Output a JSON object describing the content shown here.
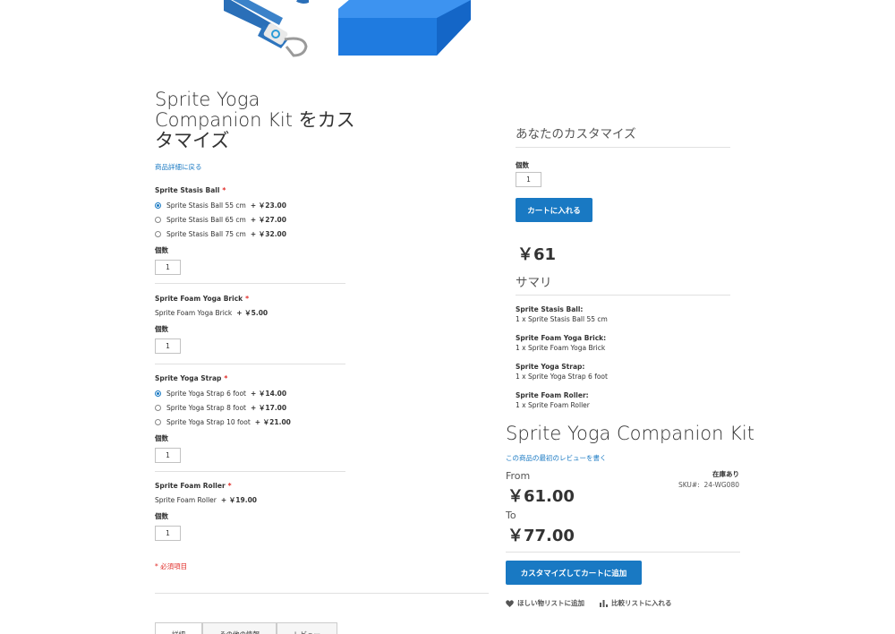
{
  "bundle": {
    "title_line1": "Sprite Yoga",
    "title_line2": "Companion Kit をカス",
    "title_line3": "タマイズ",
    "back_link": "商品詳細に戻る",
    "qty_label": "個数",
    "options": [
      {
        "label": "Sprite Stasis Ball",
        "choices": [
          {
            "name": "Sprite Stasis Ball 55 cm",
            "price": "+ ￥23.00",
            "checked": true
          },
          {
            "name": "Sprite Stasis Ball 65 cm",
            "price": "+ ￥27.00",
            "checked": false
          },
          {
            "name": "Sprite Stasis Ball 75 cm",
            "price": "+ ￥32.00",
            "checked": false
          }
        ],
        "qty": "1"
      },
      {
        "label": "Sprite Foam Yoga Brick",
        "single": {
          "name": "Sprite Foam Yoga Brick",
          "price": "+ ￥5.00"
        },
        "qty": "1"
      },
      {
        "label": "Sprite Yoga Strap",
        "choices": [
          {
            "name": "Sprite Yoga Strap 6 foot",
            "price": "+ ￥14.00",
            "checked": true
          },
          {
            "name": "Sprite Yoga Strap 8 foot",
            "price": "+ ￥17.00",
            "checked": false
          },
          {
            "name": "Sprite Yoga Strap 10 foot",
            "price": "+ ￥21.00",
            "checked": false
          }
        ],
        "qty": "1"
      },
      {
        "label": "Sprite Foam Roller",
        "single": {
          "name": "Sprite Foam Roller",
          "price": "+ ￥19.00"
        },
        "qty": "1"
      }
    ],
    "required_star": "*",
    "required_note": "* 必須項目"
  },
  "tabs": [
    "詳細",
    "その他の情報",
    "レビュー"
  ],
  "customize": {
    "title": "あなたのカスタマイズ",
    "qty_label": "個数",
    "qty": "1",
    "add_to_cart": "カートに入れる",
    "price": "￥61",
    "summary_title": "サマリ",
    "summary": [
      {
        "label": "Sprite Stasis Ball:",
        "value": "1 x Sprite Stasis Ball 55 cm"
      },
      {
        "label": "Sprite Foam Yoga Brick:",
        "value": "1 x Sprite Foam Yoga Brick"
      },
      {
        "label": "Sprite Yoga Strap:",
        "value": "1 x Sprite Yoga Strap 6 foot"
      },
      {
        "label": "Sprite Foam Roller:",
        "value": "1 x Sprite Foam Roller"
      }
    ]
  },
  "product": {
    "name": "Sprite Yoga Companion Kit",
    "review_link": "この商品の最初のレビューを書く",
    "from_label": "From",
    "from_price": "￥61.00",
    "to_label": "To",
    "to_price": "￥77.00",
    "stock": "在庫あり",
    "sku_label": "SKU#:",
    "sku": "24-WG080",
    "customize_button": "カスタマイズしてカートに追加",
    "wishlist": "ほしい物リストに追加",
    "compare": "比較リストに入れる"
  },
  "colors": {
    "accent": "#1979c3",
    "required": "#e02b27"
  }
}
